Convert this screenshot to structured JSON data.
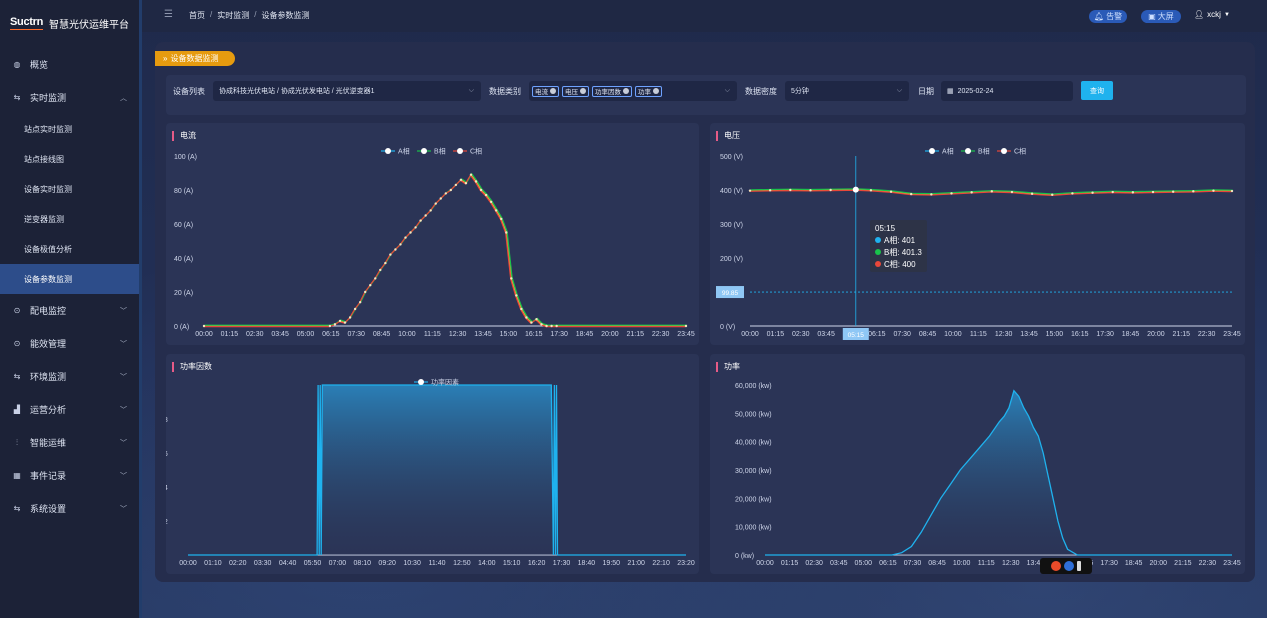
{
  "app": {
    "logo": "Suctrn",
    "logo_sub": "上海伏电电器有限",
    "title": "智慧光伏运维平台"
  },
  "sidebar": {
    "items": [
      {
        "label": "概览",
        "icon": "dashboard-icon",
        "glyph": "◍",
        "expanded": false,
        "has_arrow": false
      },
      {
        "label": "实时监测",
        "icon": "monitor-icon",
        "glyph": "⇆",
        "expanded": true,
        "has_arrow": true,
        "children": [
          {
            "label": "站点实时监测",
            "active": false
          },
          {
            "label": "站点接线图",
            "active": false
          },
          {
            "label": "设备实时监测",
            "active": false
          },
          {
            "label": "逆变器监测",
            "active": false
          },
          {
            "label": "设备极值分析",
            "active": false
          },
          {
            "label": "设备参数监测",
            "active": true
          }
        ]
      },
      {
        "label": "配电监控",
        "icon": "power-icon",
        "glyph": "⊙",
        "has_arrow": true
      },
      {
        "label": "能效管理",
        "icon": "energy-icon",
        "glyph": "⊙",
        "has_arrow": true
      },
      {
        "label": "环境监测",
        "icon": "env-icon",
        "glyph": "⇆",
        "has_arrow": true
      },
      {
        "label": "运营分析",
        "icon": "analysis-icon",
        "glyph": "▟",
        "has_arrow": true
      },
      {
        "label": "智能运维",
        "icon": "maintenance-icon",
        "glyph": "⫶",
        "has_arrow": true
      },
      {
        "label": "事件记录",
        "icon": "event-icon",
        "glyph": "▦",
        "has_arrow": true
      },
      {
        "label": "系统设置",
        "icon": "settings-icon",
        "glyph": "⇆",
        "has_arrow": true
      }
    ]
  },
  "header": {
    "breadcrumb": [
      "首页",
      "实时监测",
      "设备参数监测"
    ],
    "alarm": "告警",
    "bigscreen": "大屏",
    "user": "xckj"
  },
  "panel_tag": "设备数据监测",
  "filters": {
    "device_label": "设备列表",
    "device_value": "协成科技光伏电站 / 协成光伏发电站 / 光伏逆变器1",
    "type_label": "数据类别",
    "types": [
      "电流",
      "电压",
      "功率因数",
      "功率"
    ],
    "density_label": "数据密度",
    "density_value": "5分钟",
    "date_label": "日期",
    "date_value": "2025-02-24",
    "query": "查询"
  },
  "tooltip": {
    "time": "05:15",
    "rows": [
      {
        "label": "A相: 401",
        "color": "#1fb2ee"
      },
      {
        "label": "B相: 401.3",
        "color": "#19c24a"
      },
      {
        "label": "C相: 400",
        "color": "#e8473a"
      }
    ]
  },
  "chart_data": [
    {
      "id": "current",
      "type": "line",
      "title": "电流",
      "legend": [
        "A相",
        "B相",
        "C相"
      ],
      "colors": [
        "#f0b040",
        "#19c24a",
        "#e8473a"
      ],
      "yticks": [
        "0 (A)",
        "20 (A)",
        "40 (A)",
        "60 (A)",
        "80 (A)",
        "100 (A)"
      ],
      "ylim": [
        0,
        100
      ],
      "xticks": [
        "00:00",
        "01:15",
        "02:30",
        "03:45",
        "05:00",
        "06:15",
        "07:30",
        "08:45",
        "10:00",
        "11:15",
        "12:30",
        "13:45",
        "15:00",
        "16:15",
        "17:30",
        "18:45",
        "20:00",
        "21:15",
        "22:30",
        "23:45"
      ],
      "x_hours": [
        0,
        6.25,
        6.5,
        6.75,
        7,
        7.25,
        7.5,
        7.75,
        8,
        8.25,
        8.5,
        8.75,
        9,
        9.25,
        9.5,
        9.75,
        10,
        10.25,
        10.5,
        10.75,
        11,
        11.25,
        11.5,
        11.75,
        12,
        12.25,
        12.5,
        12.75,
        13,
        13.25,
        13.5,
        13.75,
        14,
        14.25,
        14.5,
        14.75,
        15,
        15.25,
        15.5,
        15.75,
        16,
        16.25,
        16.5,
        16.75,
        17,
        17.25,
        17.5,
        23.92
      ],
      "values": [
        0,
        0,
        1,
        3,
        2,
        5,
        10,
        14,
        20,
        24,
        28,
        33,
        37,
        42,
        45,
        48,
        52,
        55,
        58,
        62,
        65,
        68,
        72,
        75,
        78,
        80,
        83,
        86,
        84,
        89,
        85,
        80,
        77,
        73,
        68,
        63,
        55,
        28,
        18,
        10,
        5,
        2,
        4,
        1,
        0,
        0,
        0,
        0
      ]
    },
    {
      "id": "voltage",
      "type": "line",
      "title": "电压",
      "legend": [
        "A相",
        "B相",
        "C相"
      ],
      "colors": [
        "#f0b040",
        "#19c24a",
        "#e8473a"
      ],
      "yticks": [
        "0 (V)",
        "100 (V)",
        "200 (V)",
        "300 (V)",
        "400 (V)",
        "500 (V)"
      ],
      "ylim": [
        0,
        500
      ],
      "xticks": [
        "00:00",
        "01:15",
        "02:30",
        "03:45",
        "05:00",
        "06:15",
        "07:30",
        "08:45",
        "10:00",
        "11:15",
        "12:30",
        "13:45",
        "15:00",
        "16:15",
        "17:30",
        "18:45",
        "20:00",
        "21:15",
        "22:30",
        "23:45"
      ],
      "x_hours": [
        0,
        1,
        2,
        3,
        4,
        5.25,
        6,
        7,
        8,
        9,
        10,
        11,
        12,
        13,
        14,
        15,
        16,
        17,
        18,
        19,
        20,
        21,
        22,
        23,
        23.92
      ],
      "values": [
        398,
        399,
        400,
        399,
        400,
        401,
        399,
        395,
        388,
        387,
        390,
        393,
        396,
        394,
        389,
        386,
        390,
        392,
        394,
        393,
        394,
        395,
        396,
        398,
        397
      ],
      "markline": "99.85",
      "marker_x": "05:15"
    },
    {
      "id": "pf",
      "type": "area",
      "title": "功率因数",
      "legend": [
        "功率因素"
      ],
      "colors": [
        "#1fb2ee"
      ],
      "yticks": [
        "0",
        "0.2",
        "0.4",
        "0.6",
        "0.8",
        "1"
      ],
      "ylim": [
        0,
        1
      ],
      "xticks": [
        "00:00",
        "01:10",
        "02:20",
        "03:30",
        "04:40",
        "05:50",
        "07:00",
        "08:10",
        "09:20",
        "10:30",
        "11:40",
        "12:50",
        "14:00",
        "15:10",
        "16:20",
        "17:30",
        "18:40",
        "19:50",
        "21:00",
        "22:10",
        "23:20"
      ],
      "x_hours": [
        0,
        6.2,
        6.25,
        6.3,
        6.35,
        6.4,
        6.45,
        6.55,
        17.45,
        17.55,
        17.6,
        17.65,
        17.7,
        17.75,
        17.8,
        23.92
      ],
      "values": [
        0,
        0,
        1,
        0,
        1,
        0,
        1,
        1,
        1,
        0,
        1,
        0,
        1,
        0,
        0,
        0
      ]
    },
    {
      "id": "power",
      "type": "area",
      "title": "功率",
      "colors": [
        "#1fb2ee"
      ],
      "yticks": [
        "0 (kw)",
        "10,000 (kw)",
        "20,000 (kw)",
        "30,000 (kw)",
        "40,000 (kw)",
        "50,000 (kw)",
        "60,000 (kw)"
      ],
      "ylim": [
        0,
        60000
      ],
      "xticks": [
        "00:00",
        "01:15",
        "02:30",
        "03:45",
        "05:00",
        "06:15",
        "07:30",
        "08:45",
        "10:00",
        "11:15",
        "12:30",
        "13:45",
        "15:00",
        "16:15",
        "17:30",
        "18:45",
        "20:00",
        "21:15",
        "22:30",
        "23:45"
      ],
      "x_hours": [
        0,
        6.5,
        7,
        7.5,
        8,
        8.5,
        9,
        9.5,
        10,
        10.5,
        11,
        11.5,
        12,
        12.25,
        12.5,
        12.75,
        13,
        13.25,
        13.5,
        13.75,
        14,
        14.25,
        14.5,
        14.75,
        15,
        15.25,
        15.5,
        16,
        23.92
      ],
      "values": [
        0,
        0,
        800,
        3000,
        8000,
        14000,
        20000,
        25000,
        30000,
        34000,
        38000,
        42000,
        47000,
        49000,
        52000,
        58000,
        56000,
        52000,
        49000,
        45000,
        42000,
        36000,
        28000,
        20000,
        12000,
        6000,
        2000,
        0,
        0
      ]
    }
  ]
}
